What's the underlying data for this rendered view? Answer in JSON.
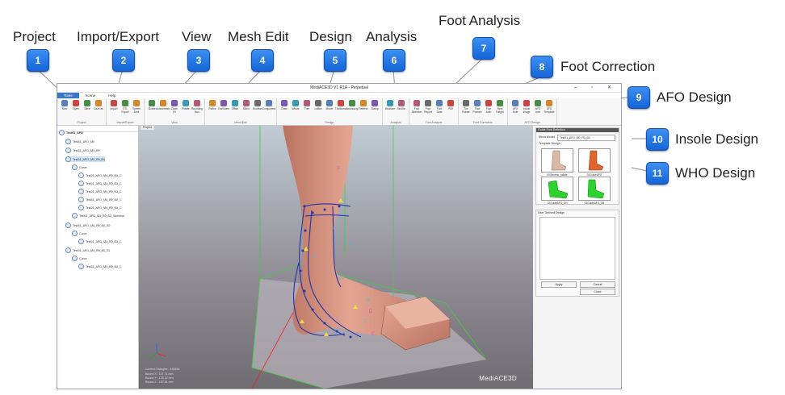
{
  "callouts": [
    {
      "num": "1",
      "label": "Project"
    },
    {
      "num": "2",
      "label": "Import/Export"
    },
    {
      "num": "3",
      "label": "View"
    },
    {
      "num": "4",
      "label": "Mesh Edit"
    },
    {
      "num": "5",
      "label": "Design"
    },
    {
      "num": "6",
      "label": "Analysis"
    },
    {
      "num": "7",
      "label": "Foot Analysis"
    },
    {
      "num": "8",
      "label": "Foot Correction"
    },
    {
      "num": "9",
      "label": "AFO Design"
    },
    {
      "num": "10",
      "label": "Insole Design"
    },
    {
      "num": "11",
      "label": "WHO Design"
    }
  ],
  "app": {
    "title": "MediACE3D V1 R1A - Perpetual",
    "window_buttons": "– ▫ ✕",
    "menu": [
      "Tools",
      "Scene",
      "Help"
    ],
    "ribbon": {
      "groups": [
        {
          "name": "Project",
          "buttons": [
            "New",
            "Open",
            "Save",
            "Save as"
          ]
        },
        {
          "name": "Import/Export",
          "buttons": [
            "Import",
            "STL Export",
            "Screen Shot"
          ]
        },
        {
          "name": "View",
          "buttons": [
            "Shade",
            "Axonometric",
            "Zoom Fit",
            "Rotate",
            "Bounding Box"
          ]
        },
        {
          "name": "Mesh Edit",
          "buttons": [
            "Refine",
            "Transform",
            "Offset",
            "Mirror",
            "Boolean",
            "Component"
          ]
        },
        {
          "name": "Design",
          "buttons": [
            "Draw",
            "Whole",
            "Trim",
            "Lattice",
            "Model",
            "Thickness",
            "Accessory",
            "Refresh",
            "Stamp"
          ]
        },
        {
          "name": "Analysis",
          "buttons": [
            "Measure",
            "Section"
          ]
        },
        {
          "name": "Foot Analysis",
          "buttons": [
            "Foot Skeleton",
            "Foot Report",
            "Foot Data",
            "PMI"
          ]
        },
        {
          "name": "Foot Correction",
          "buttons": [
            "Toe Rotate",
            "Foot Posture",
            "Foot Arch",
            "Heel Height"
          ]
        },
        {
          "name": "AFO Design",
          "buttons": [
            "AFO Sole",
            "Insole Image",
            "AFO Arch",
            "AFO Template"
          ]
        }
      ]
    },
    "tree": {
      "nodes": [
        {
          "label": "Test01_AFO",
          "bold": true
        },
        {
          "label": "Test01_AFO_M0"
        },
        {
          "label": "Test01_AFO_M0_R0"
        },
        {
          "label": "Test01_AFO_M0_R0_B0",
          "selected": true
        },
        {
          "label": "Curve"
        },
        {
          "label": "Test01_AFO_M0_R0_B0_C"
        },
        {
          "label": "Test01_AFO_M0_R0_B0_C"
        },
        {
          "label": "Test01_AFO_M0_R0_B0_C"
        },
        {
          "label": "Test01_AFO_M0_R0_B0_C"
        },
        {
          "label": "Test01_AFO_M0_R0_B0_C"
        },
        {
          "label": "Test01_AFO_M0_R0_B0_Skeleton"
        },
        {
          "label": "Test01_AFO_M0_R0_B0_S0"
        },
        {
          "label": "Curve"
        },
        {
          "label": "Test01_AFO_M0_R0_B0_C"
        },
        {
          "label": "Test01_AFO_M0_R0_B0_S1"
        },
        {
          "label": "Curve"
        },
        {
          "label": "Test01_AFO_M0_R0_B0_C"
        }
      ]
    },
    "viewport": {
      "tab": "Project",
      "status_lines": [
        "Current Triangles : 435594",
        "Bound X : 117.71 mm",
        "Bound Y : 123.12 mm",
        "Bound Z : 157.81 mm"
      ],
      "logo": "MediACE3D",
      "labels": [
        "F",
        "F",
        "A",
        "B",
        "B",
        "C",
        "D",
        "E",
        "F"
      ]
    },
    "panel": {
      "header": "Guide Foot Definition",
      "field_label": "Mesh Model",
      "field_value": "Test01_AFO_M0_R0_B0",
      "templates_header": "Template Design",
      "templates": [
        "00Generic_Inflate",
        "01GuideAFO",
        "02GuideAFO_SH",
        "03GuideAFO_SB"
      ],
      "list_header": "User Defined Design",
      "apply": "Apply",
      "cancel": "Cancel",
      "close": "Close"
    }
  },
  "colors": {
    "badge": "#1f6fe0",
    "foot_skin": "#dc9a86",
    "curve": "#2233aa",
    "guide_green": "#2ec82e",
    "template_green": "#2fd12f"
  }
}
